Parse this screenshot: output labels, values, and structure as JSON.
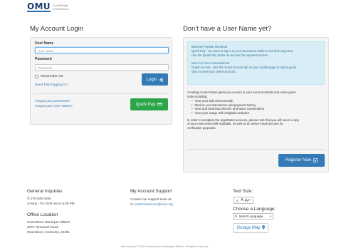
{
  "brand": {
    "name": "OMU",
    "tagline": "Local People. Local Service."
  },
  "login": {
    "title": "My Account Login",
    "username_label": "User Name",
    "username_placeholder": "User Name",
    "password_label": "Password",
    "password_placeholder": "Password",
    "remember": "Remember me",
    "help": "Need help logging in?",
    "login_btn": "Login",
    "forgot_password": "Forgot your password?",
    "forgot_username": "Forgot your User Name?",
    "quick_pay": "Quick Pay"
  },
  "signup": {
    "title": "Don't have a User Name yet?",
    "info_lines": [
      "Back By Popular Demand!",
      "Quick Pay - No need to log in to your account to make a one time payment.",
      "Use the Quick Pay button to access the payment screen.",
      "New For Your Convenience!",
      "Guest Access - See the Guest Access tab on your profile page to add a guest",
      "user to view your online account."
    ],
    "intro_1": "Creating a User Name gives you access to your account details and some great",
    "intro_2": "tools including:",
    "bullets": [
      "View your bills electronically",
      "Review your transaction and payment history",
      "View and download electric and water consumption",
      "View your usage with insightful analytics"
    ],
    "outro_1": "In order to complete the registration process, please note that you will need a copy",
    "outro_2": "of your most recent bill available, as well as an active email account for",
    "outro_3": "verification purposes.",
    "register_btn": "Register Now"
  },
  "footer": {
    "general_title": "General Inquiries",
    "phone": "270-926-3200",
    "hours": "Mon - Fri: 8:00 AM to 5:00 PM",
    "office_title": "Office Location",
    "office_1": "Owensboro Municipal Utilities",
    "office_2": "2070 Tamarack Road",
    "office_3": "Owensboro, Kentucky, 42301",
    "support_title": "My Account Support",
    "support_text": "Contact our support team at:",
    "support_email": "customerservice@omu.org",
    "text_size_title": "Text Size:",
    "ts_small": "A-",
    "ts_mid": "A",
    "ts_large": "A+",
    "language_title": "Choose a Language:",
    "language_value": "Select Language",
    "outage": "Outage Map",
    "copyright": "All contents © 2016 Owensboro Municipal Utilities. All rights reserved."
  },
  "colors": {
    "primary": "#337ab7",
    "success": "#2ca54a",
    "info_bg": "#d9edf7"
  }
}
